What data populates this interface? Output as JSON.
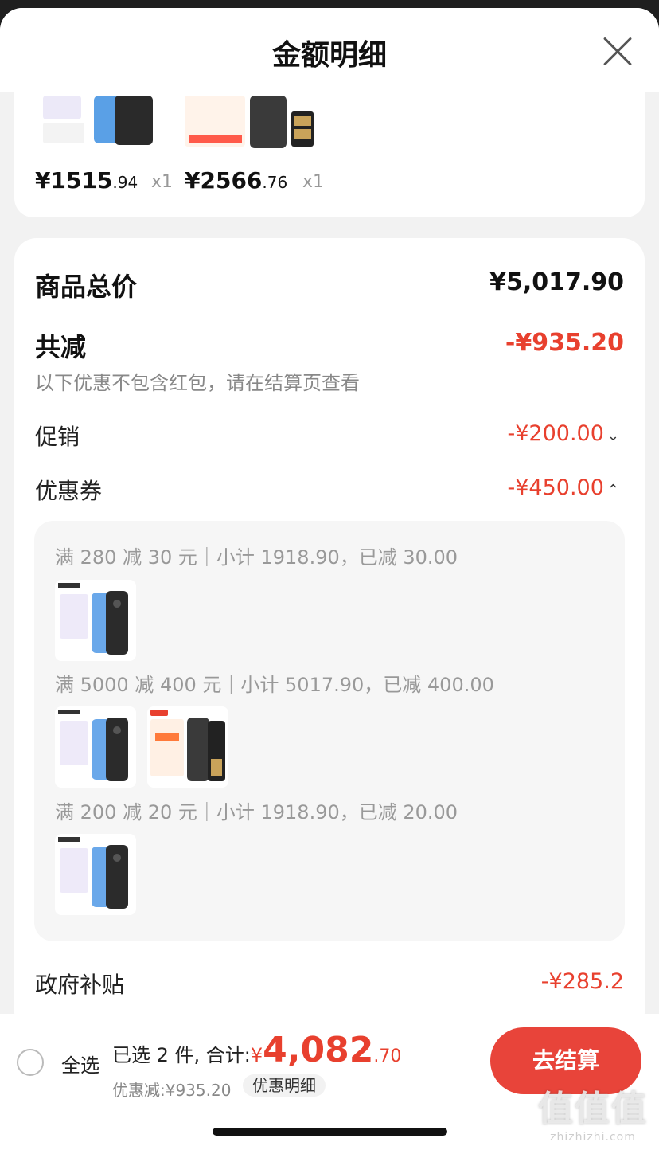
{
  "header": {
    "title": "金额明细"
  },
  "products": [
    {
      "price_int": "1515",
      "price_dec": ".94",
      "currency": "¥",
      "qty": "x1"
    },
    {
      "price_int": "2566",
      "price_dec": ".76",
      "currency": "¥",
      "qty": "x1"
    }
  ],
  "summary": {
    "total_label": "商品总价",
    "total_value": "¥5,017.90",
    "reduce_label": "共减",
    "reduce_value": "-¥935.20",
    "reduce_note": "以下优惠不包含红包，请在结算页查看",
    "promo_label": "促销",
    "promo_value": "-¥200.00",
    "coupon_label": "优惠券",
    "coupon_value": "-¥450.00",
    "subsidy_label": "政府补贴",
    "subsidy_value": "-¥285.2"
  },
  "coupons": [
    {
      "text": "满 280 减 30 元｜小计 1918.90，已减 30.00"
    },
    {
      "text": "满 5000 减 400 元｜小计 5017.90，已减 400.00"
    },
    {
      "text": "满 200 减 20 元｜小计 1918.90，已减 20.00"
    }
  ],
  "footer": {
    "select_all": "全选",
    "selected_text": "已选 2 件, 合计:",
    "currency": "¥",
    "total_int": "4,082",
    "total_dec": ".70",
    "discount_text": "优惠减:¥935.20",
    "detail_tag": "优惠明细",
    "checkout": "去结算"
  },
  "watermark": {
    "mark": "值值值",
    "url": "zhizhizhi.com"
  },
  "colors": {
    "accent_red": "#e8402e",
    "button_red": "#e8443a",
    "background": "#f2f2f2"
  }
}
